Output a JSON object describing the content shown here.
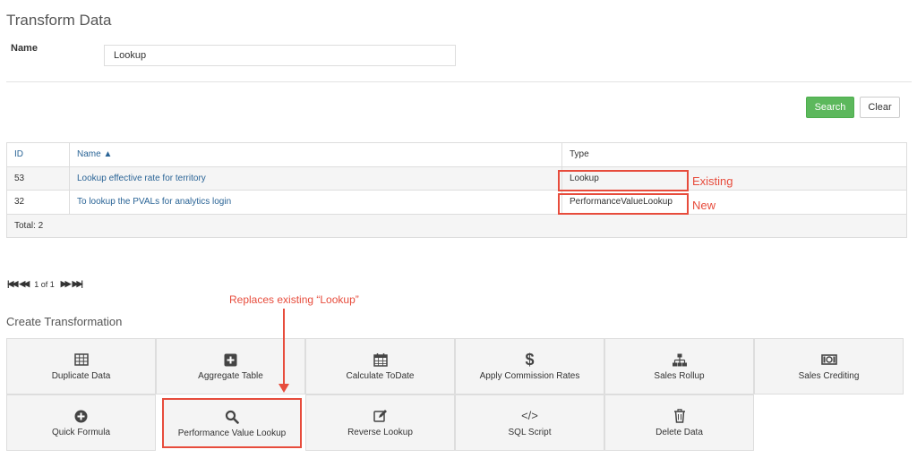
{
  "page": {
    "title": "Transform Data"
  },
  "form": {
    "name_label": "Name",
    "name_value": "Lookup"
  },
  "buttons": {
    "search": "Search",
    "clear": "Clear"
  },
  "table": {
    "headers": {
      "id": "ID",
      "name": "Name ▲",
      "type": "Type"
    },
    "rows": [
      {
        "id": "53",
        "name": "Lookup effective rate for territory",
        "type": "Lookup"
      },
      {
        "id": "32",
        "name": "To lookup the PVALs for analytics login",
        "type": "PerformanceValueLookup"
      }
    ],
    "total": "Total: 2"
  },
  "pager": {
    "first": "|◀◀",
    "prev": "◀◀",
    "text": "1 of 1",
    "next": "▶▶",
    "last": "▶▶|"
  },
  "annotations": {
    "existing": "Existing",
    "new": "New",
    "replaces": "Replaces existing “Lookup”"
  },
  "section": {
    "create_title": "Create Transformation"
  },
  "tiles": [
    {
      "label": "Duplicate Data",
      "icon": "table-icon"
    },
    {
      "label": "Aggregate Table",
      "icon": "plus-square-icon"
    },
    {
      "label": "Calculate ToDate",
      "icon": "calendar-icon"
    },
    {
      "label": "Apply Commission Rates",
      "icon": "dollar-icon"
    },
    {
      "label": "Sales Rollup",
      "icon": "sitemap-icon"
    },
    {
      "label": "Sales Crediting",
      "icon": "money-icon"
    },
    {
      "label": "Quick Formula",
      "icon": "plus-circle-icon"
    },
    {
      "label": "Performance Value Lookup",
      "icon": "search-icon"
    },
    {
      "label": "Reverse Lookup",
      "icon": "edit-icon"
    },
    {
      "label": "SQL Script",
      "icon": "code-icon"
    },
    {
      "label": "Delete Data",
      "icon": "trash-icon"
    }
  ],
  "colors": {
    "accent_red": "#e74c3c",
    "search_green": "#5cb85c",
    "link_blue": "#2a6496"
  }
}
